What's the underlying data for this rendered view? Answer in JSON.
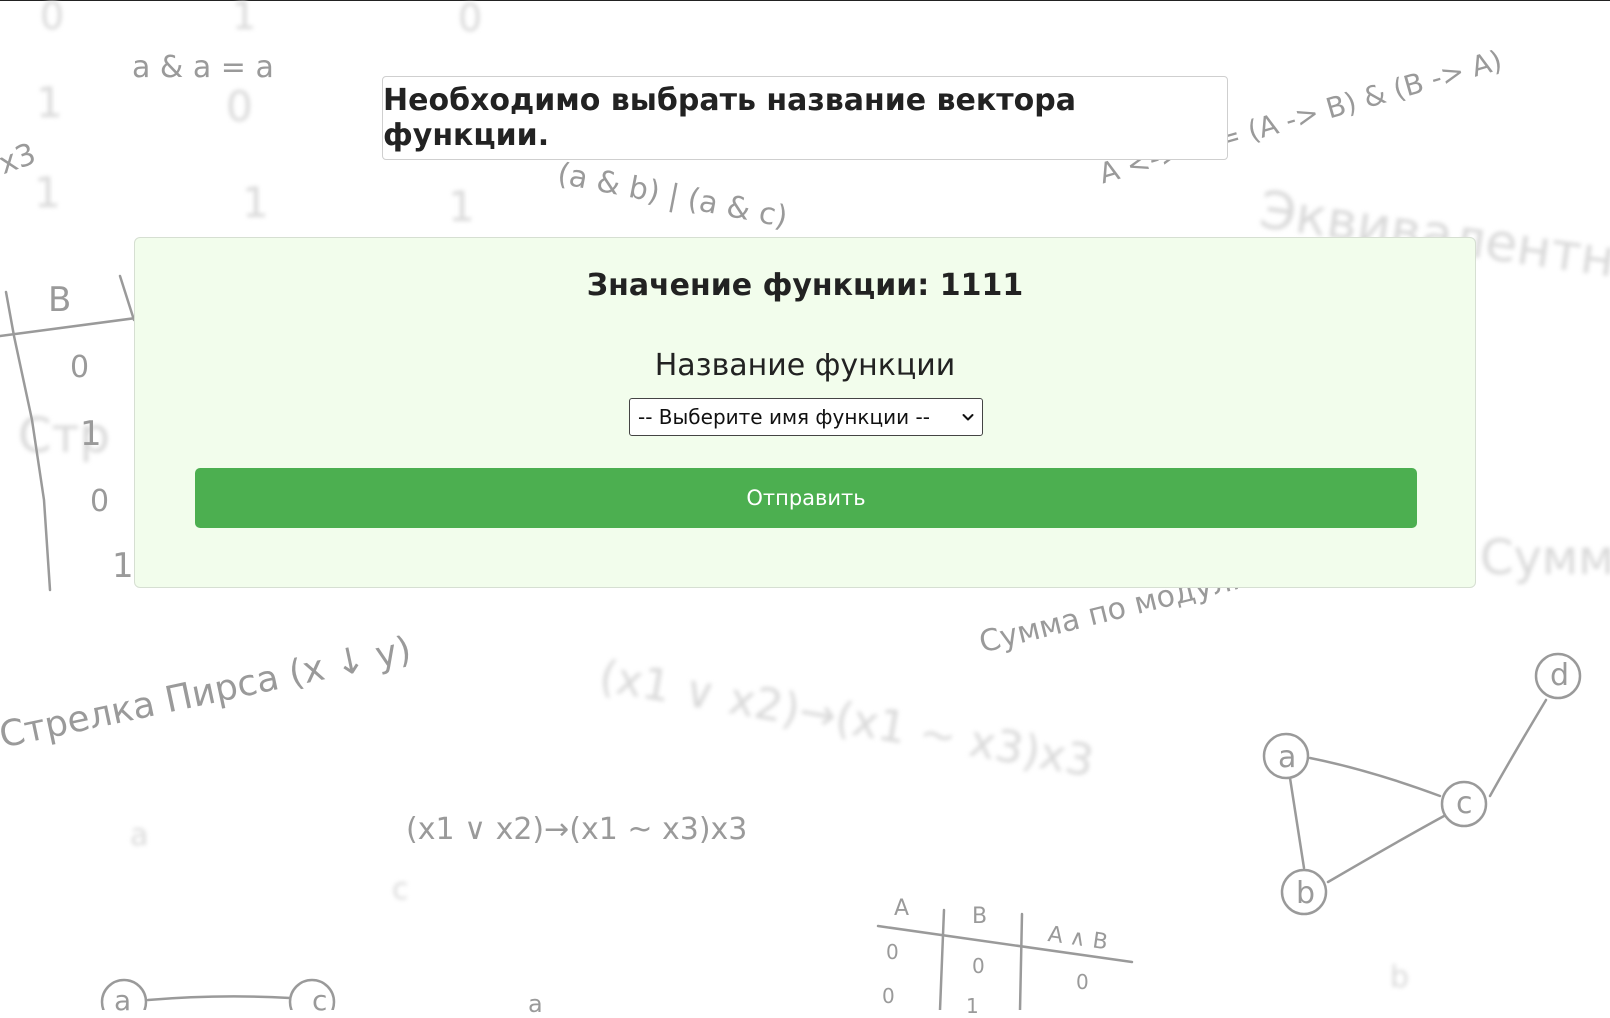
{
  "instruction": {
    "text": "Необходимо выбрать название вектора функции."
  },
  "card": {
    "title": "Значение функции: 1111",
    "label": "Название функции",
    "select": {
      "selected": "-- Выберите имя функции --"
    },
    "submit_label": "Отправить"
  },
  "background": {
    "doodles": [
      "a & a = a",
      "(a & b) | (a & c)",
      "A <-> B = (A -> B) & (B -> A)",
      "Сумма по модулю",
      "Стрелка Пирса (x ↓ y)",
      "(x1 ∨ x2)→(x1 ~ x3)x3",
      "x3"
    ],
    "faint_doodles": [
      "Эквивалентность",
      "(x1 ∨ x2)→(x1 ~ x3)x3",
      "Стр",
      "Сумм"
    ],
    "left_table": {
      "header": "B",
      "values": [
        "0",
        "1",
        "0",
        "1"
      ]
    },
    "bottom_table": {
      "headers": [
        "A",
        "B",
        "A ∧ B"
      ],
      "col_a": [
        "0",
        "0"
      ],
      "col_b": [
        "0",
        "1"
      ],
      "col_ab": [
        "0"
      ]
    },
    "graph_nodes": [
      "a",
      "b",
      "c",
      "d"
    ],
    "bottom_nodes": [
      "a",
      "c",
      "a"
    ],
    "faint_digits": [
      "0",
      "1",
      "0",
      "1",
      "0",
      "1",
      "1",
      "1",
      "a",
      "b",
      "c"
    ]
  },
  "colors": {
    "card_background": "#f2fdec",
    "button": "#4caf50",
    "doodle": "#9a9a9a"
  }
}
